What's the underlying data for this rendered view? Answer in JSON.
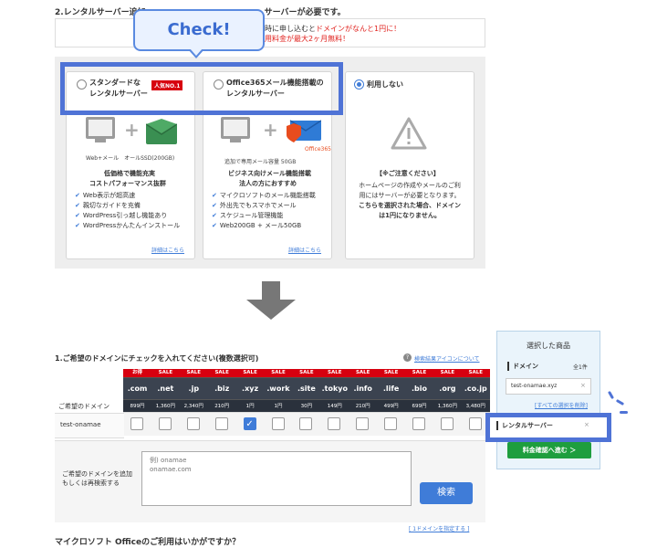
{
  "colors": {
    "accent_blue": "#3f7cd8",
    "highlight_frame": "#4f73d6",
    "sale_red": "#d7000f",
    "tld_header_dark": "#3b4350",
    "cta_green": "#1e9e3e",
    "promo_red": "#e0201c"
  },
  "server_section": {
    "title": "2.レンタルサーバー追加",
    "title_tail": "サーバーが必要です。",
    "promo_line1_prefix": "同時に申し込むと",
    "promo_line1_highlight": "ドメインがなんと1円に！",
    "promo_line2": "利用料金が最大2ヶ月無料！",
    "check_bubble": "Check!",
    "cards": [
      {
        "title_line1": "スタンダードな",
        "title_line2": "レンタルサーバー",
        "badge": "人気NO.1",
        "selected": false,
        "icon_caption": "Web+メール　オールSSD(200GB)",
        "headline_line1": "低価格で機能充実",
        "headline_line2": "コストパフォーマンス抜群",
        "features": [
          "Web表示が超高速",
          "親切なガイドを充備",
          "WordPress引っ越し機能あり",
          "WordPressかんたんインストール"
        ],
        "details_link": "詳細はこちら"
      },
      {
        "title_line1": "Office365メール機能搭載の",
        "title_line2": "レンタルサーバー",
        "selected": false,
        "office_label": "Office365",
        "icon_caption": "追加で専用メール容量 50GB",
        "headline_line1": "ビジネス向けメール機能搭載",
        "headline_line2": "法人の方におすすめ",
        "features": [
          "マイクロソフトのメール機能搭載",
          "外出先でもスマホでメール",
          "スケジュール管理機能",
          "Web200GB + メール50GB"
        ],
        "details_link": "詳細はこちら"
      },
      {
        "title_line1": "利用しない",
        "selected": true,
        "notice_heading": "【※ご注意ください】",
        "notice_lines": [
          "ホームページの作成やメールのご利",
          "用にはサーバーが必要となります。",
          "こちらを選択された場合、ドメイン",
          "は1円になりません。"
        ]
      }
    ]
  },
  "domain_section": {
    "title": "1.ご希望のドメインにチェックを入れてください(複数選択可)",
    "icon_help_label": "?",
    "icon_help_link": "検索結果アイコンについて",
    "row_header": "ご希望のドメイン",
    "row_name": "test-onamae",
    "tlds": [
      {
        "badge": "お得",
        "name": ".com",
        "price": "899円",
        "checked": false
      },
      {
        "badge": "SALE",
        "name": ".net",
        "price": "1,360円",
        "checked": false
      },
      {
        "badge": "SALE",
        "name": ".jp",
        "price": "2,340円",
        "checked": false
      },
      {
        "badge": "SALE",
        "name": ".biz",
        "price": "210円",
        "checked": false
      },
      {
        "badge": "SALE",
        "name": ".xyz",
        "price": "1円",
        "checked": true
      },
      {
        "badge": "SALE",
        "name": ".work",
        "price": "1円",
        "checked": false
      },
      {
        "badge": "SALE",
        "name": ".site",
        "price": "30円",
        "checked": false
      },
      {
        "badge": "SALE",
        "name": ".tokyo",
        "price": "149円",
        "checked": false
      },
      {
        "badge": "SALE",
        "name": ".info",
        "price": "210円",
        "checked": false
      },
      {
        "badge": "SALE",
        "name": ".life",
        "price": "499円",
        "checked": false
      },
      {
        "badge": "SALE",
        "name": ".bio",
        "price": "699円",
        "checked": false
      },
      {
        "badge": "SALE",
        "name": ".org",
        "price": "1,360円",
        "checked": false
      },
      {
        "badge": "SALE",
        "name": ".co.jp",
        "price": "3,480円",
        "checked": false
      }
    ],
    "add_label_line1": "ご希望のドメインを追加",
    "add_label_line2": "もしくは再検索する",
    "textarea_placeholder": "例) onamae\nonamae.com",
    "search_button": "検索",
    "add_domain_link": "[ 1ドメインを指定する ]",
    "office_question": "マイクロソフト Officeのご利用はいかがですか？"
  },
  "side_panel": {
    "title": "選択した商品",
    "domain_heading": "ドメイン",
    "domain_count": "全1件",
    "domain_value": "test-onamae.xyz",
    "remove_icon": "×",
    "clear_link": "[すべての選択を削除]",
    "server_item": "レンタルサーバー",
    "cta_button": "料金確認へ進む ＞"
  }
}
